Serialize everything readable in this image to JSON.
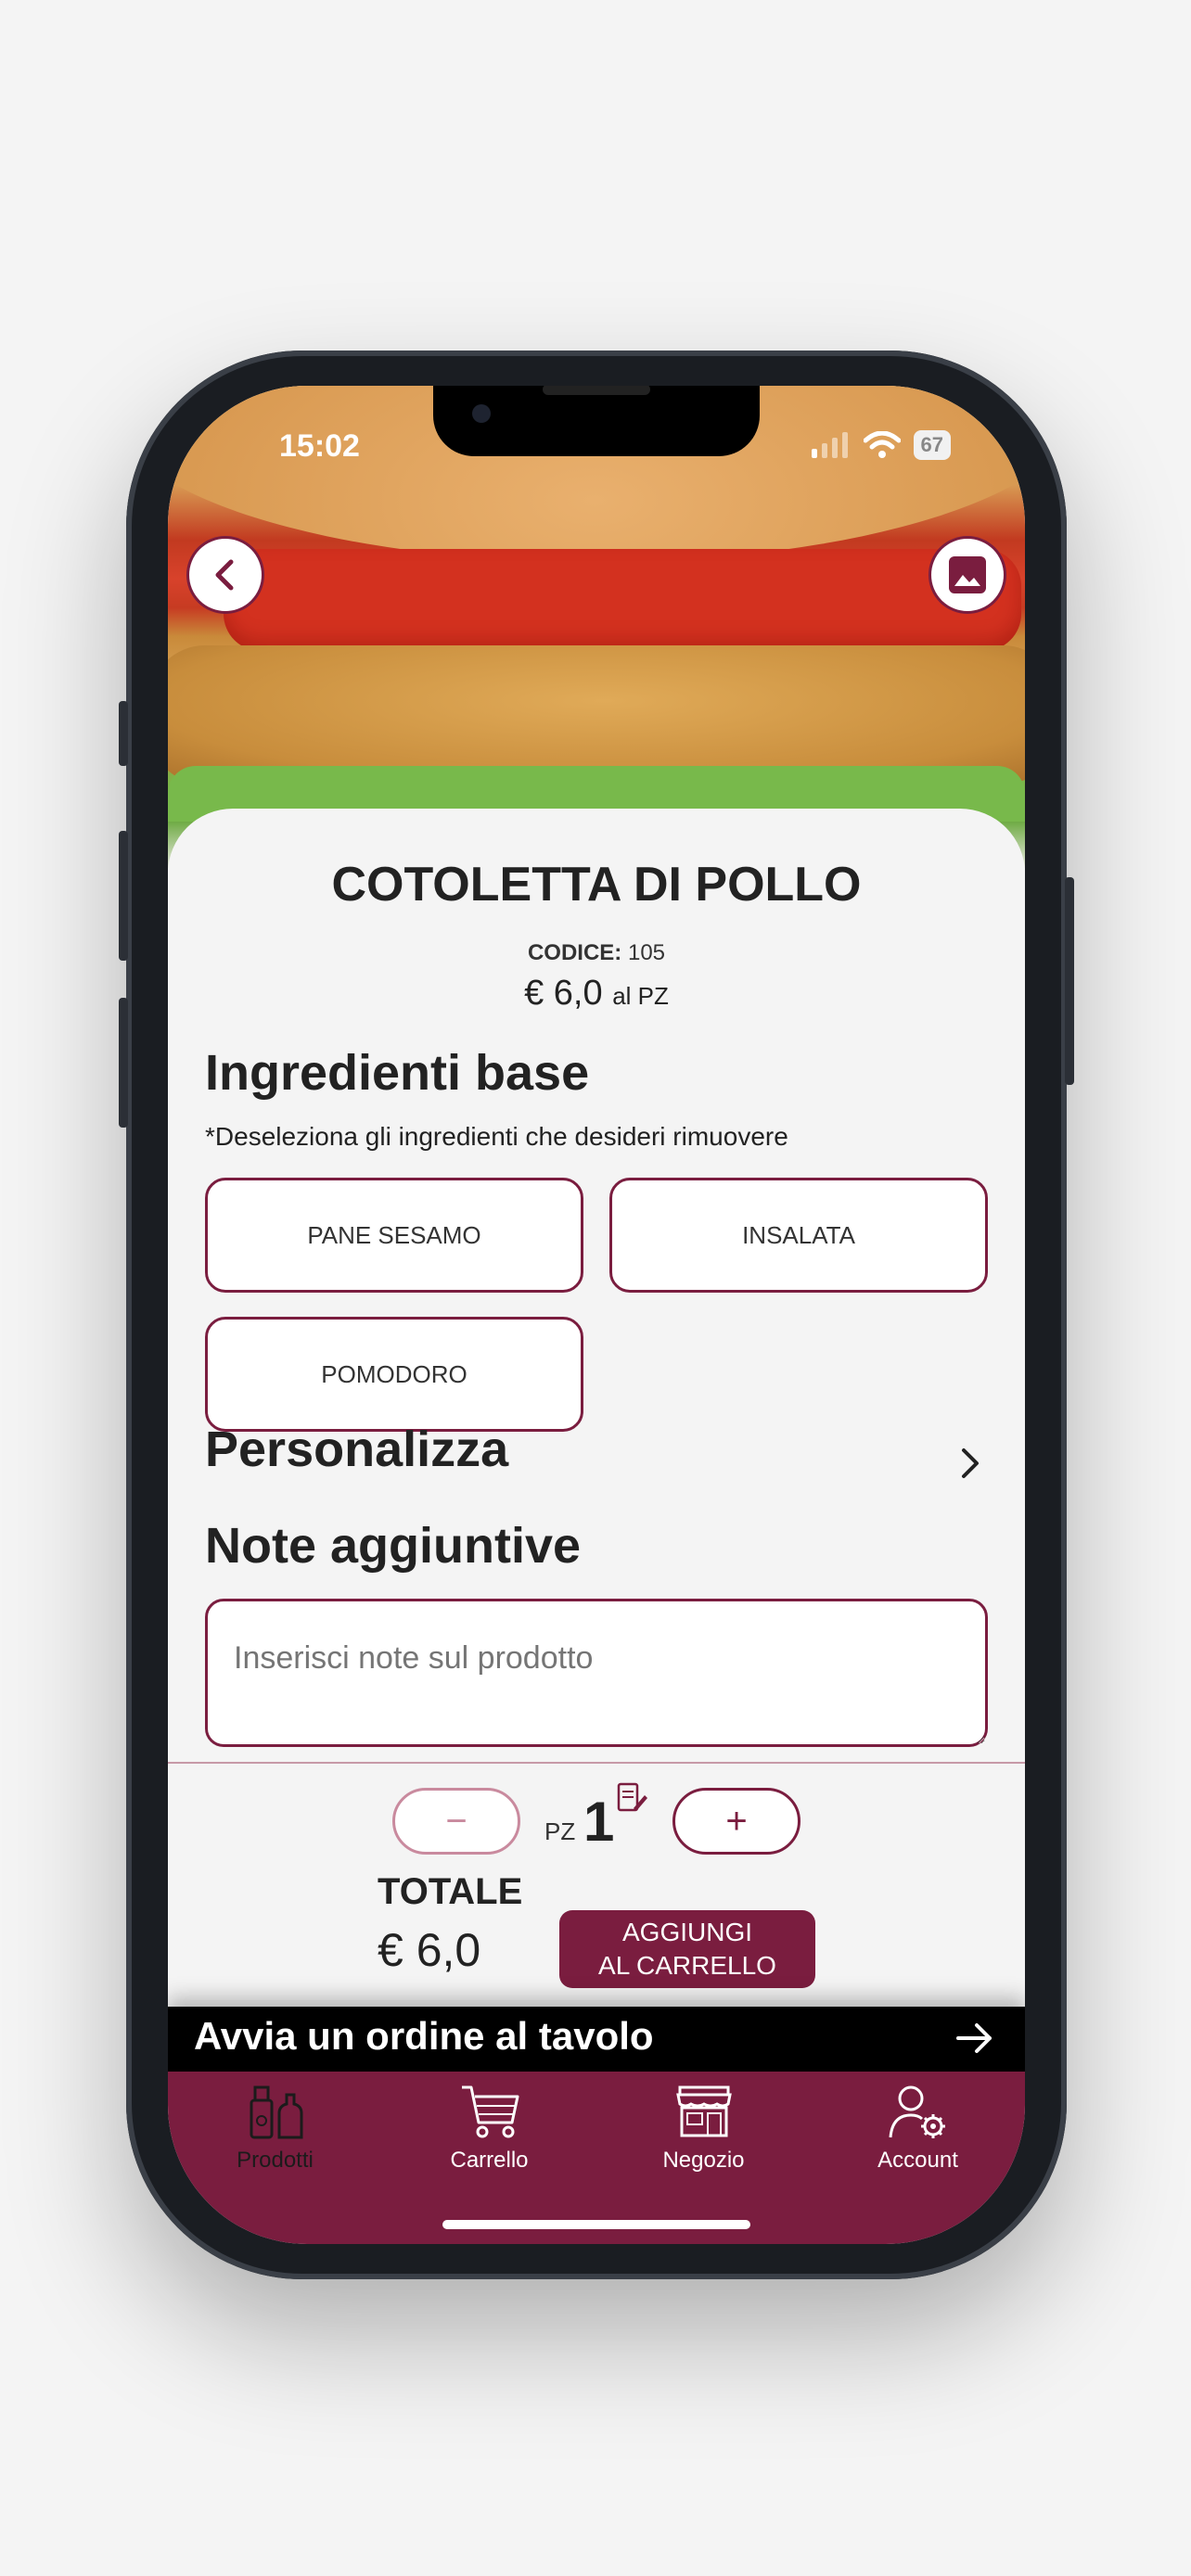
{
  "status_bar": {
    "time": "15:02",
    "battery": "67"
  },
  "product": {
    "title": "COTOLETTA DI POLLO",
    "code_label": "CODICE:",
    "code_value": "105",
    "price": "€ 6,0",
    "price_unit": "al PZ"
  },
  "ingredients": {
    "heading": "Ingredienti base",
    "hint": "*Deseleziona gli ingredienti che desideri rimuovere",
    "items": [
      "PANE SESAMO",
      "INSALATA",
      "POMODORO"
    ]
  },
  "customize": {
    "heading": "Personalizza"
  },
  "notes": {
    "heading": "Note aggiuntive",
    "placeholder": "Inserisci note sul prodotto"
  },
  "quantity": {
    "minus": "−",
    "plus": "+",
    "unit": "PZ",
    "value": "1"
  },
  "total": {
    "label": "TOTALE",
    "value": "€ 6,0",
    "add_line1": "AGGIUNGI",
    "add_line2": "AL CARRELLO"
  },
  "table_order": {
    "label": "Avvia un ordine al tavolo"
  },
  "tabs": [
    {
      "label": "Prodotti",
      "icon": "products-icon",
      "active": true
    },
    {
      "label": "Carrello",
      "icon": "cart-icon",
      "active": false
    },
    {
      "label": "Negozio",
      "icon": "store-icon",
      "active": false
    },
    {
      "label": "Account",
      "icon": "account-settings-icon",
      "active": false
    }
  ],
  "colors": {
    "brand": "#7a1d3f",
    "background": "#f4f4f4"
  }
}
